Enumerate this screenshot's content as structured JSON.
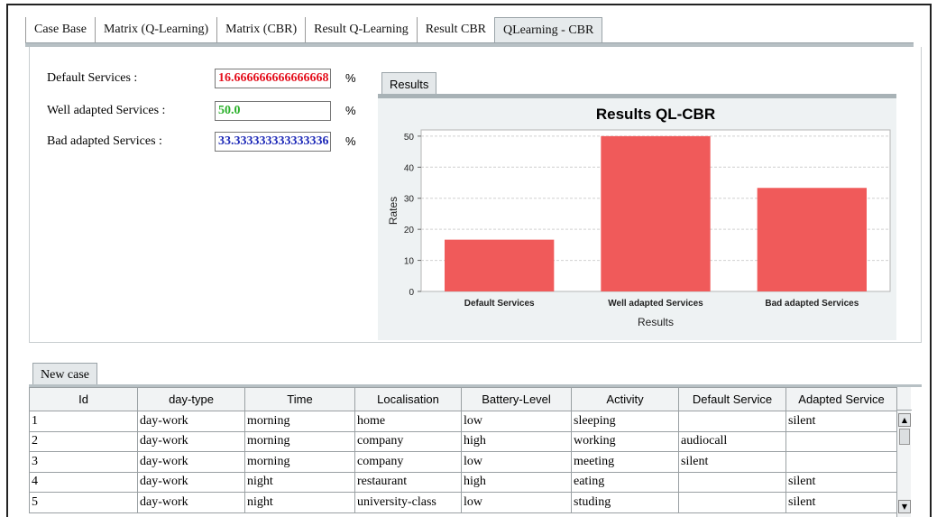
{
  "tabs": [
    {
      "label": "Case Base"
    },
    {
      "label": "Matrix (Q-Learning)"
    },
    {
      "label": "Matrix (CBR)"
    },
    {
      "label": "Result Q-Learning"
    },
    {
      "label": "Result CBR"
    },
    {
      "label": "QLearning - CBR"
    }
  ],
  "form": {
    "default": {
      "label": "Default Services  :",
      "value": "16.666666666666668",
      "unit": "%",
      "color": "#e5121f"
    },
    "well": {
      "label": "Well adapted Services :",
      "value": "50.0",
      "unit": "%",
      "color": "#2bb12b"
    },
    "bad": {
      "label": "Bad adapted Services :",
      "value": "33.333333333333336",
      "unit": "%",
      "color": "#1f2bb8"
    }
  },
  "results_tab_label": "Results",
  "chart_data": {
    "type": "bar",
    "title": "Results QL-CBR",
    "xlabel": "Results",
    "ylabel": "Rates",
    "categories": [
      "Default Services",
      "Well adapted Services",
      "Bad adapted Services"
    ],
    "values": [
      16.666666666666668,
      50.0,
      33.333333333333336
    ],
    "ylim": [
      0,
      52
    ],
    "yticks": [
      "0",
      "10",
      "20",
      "30",
      "40",
      "50"
    ],
    "bar_color": "#f05a5a",
    "grid": true
  },
  "new_case_tab_label": "New case",
  "table": {
    "columns": [
      "Id",
      "day-type",
      "Time",
      "Localisation",
      "Battery-Level",
      "Activity",
      "Default Service",
      "Adapted Service"
    ],
    "rows": [
      [
        "1",
        "day-work",
        "morning",
        "home",
        "low",
        "sleeping",
        "",
        "silent"
      ],
      [
        "2",
        "day-work",
        "morning",
        "company",
        "high",
        "working",
        "audiocall",
        ""
      ],
      [
        "3",
        "day-work",
        "morning",
        "company",
        "low",
        "meeting",
        "silent",
        ""
      ],
      [
        "4",
        "day-work",
        "night",
        "restaurant",
        "high",
        "eating",
        "",
        "silent"
      ],
      [
        "5",
        "day-work",
        "night",
        "university-class",
        "low",
        "studing",
        "",
        "silent"
      ]
    ]
  },
  "scrollbar": {
    "up_icon": "▲",
    "down_icon": "▼"
  }
}
